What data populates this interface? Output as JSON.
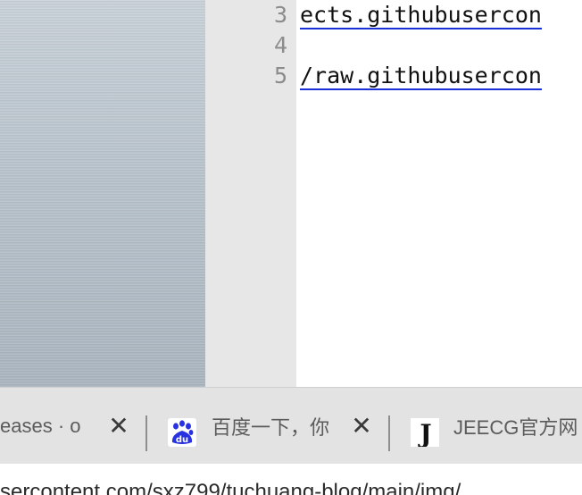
{
  "editor": {
    "lines": [
      {
        "number": "3",
        "text": "ects.githubusercon"
      },
      {
        "number": "4",
        "text": ""
      },
      {
        "number": "5",
        "text": "/raw.githubusercon"
      }
    ]
  },
  "tabs": [
    {
      "title": "eases · o",
      "close": "✕",
      "icon": "none"
    },
    {
      "title": "百度一下，你",
      "close": "✕",
      "icon": "baidu-paw-icon",
      "icon_text": "du",
      "icon_color": "#2932e1"
    },
    {
      "title": "JEECG官方网",
      "icon": "jeecg-j-icon",
      "icon_text": "J"
    }
  ],
  "address": {
    "url": "sercontent.com/sxz799/tuchuang-blog/main/img/"
  }
}
